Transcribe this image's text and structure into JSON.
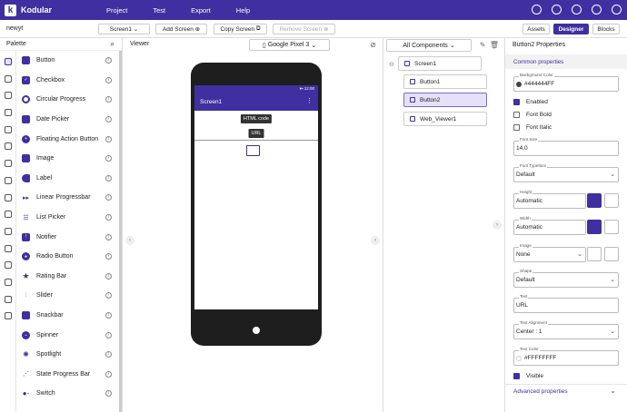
{
  "app": {
    "name": "Kodular",
    "logo_letter": "k"
  },
  "menu": [
    "Project",
    "Test",
    "Export",
    "Help"
  ],
  "toolbar": {
    "project_name": "newyt",
    "screen_select": "Screen1",
    "add_screen": "Add Screen",
    "copy_screen": "Copy Screen",
    "remove_screen": "Remove Screen",
    "assets": "Assets",
    "designer": "Designer",
    "blocks": "Blocks"
  },
  "palette": {
    "title": "Palette",
    "items": [
      "Button",
      "Checkbox",
      "Circular Progress",
      "Date Picker",
      "Floating Action Button",
      "Image",
      "Label",
      "Linear Progressbar",
      "List Picker",
      "Notifier",
      "Radio Button",
      "Rating Bar",
      "Slider",
      "Snackbar",
      "Spinner",
      "Spotlight",
      "State Progress Bar",
      "Switch"
    ]
  },
  "viewer": {
    "title": "Viewer",
    "device": "Google Pixel 3",
    "status_time": "12:00",
    "screen_title": "Screen1",
    "button1_text": "HTML code",
    "button2_text": "URL"
  },
  "components": {
    "filter": "All Components",
    "tree": [
      "Screen1",
      "Button1",
      "Button2",
      "Web_Viewer1"
    ]
  },
  "properties": {
    "title": "Button2 Properties",
    "section": "Common properties",
    "background_color_label": "Background Color",
    "background_color": "#444444FF",
    "enabled": "Enabled",
    "font_bold": "Font Bold",
    "font_italic": "Font Italic",
    "font_size_label": "Font Size",
    "font_size": "14.0",
    "font_typeface_label": "Font Typeface",
    "font_typeface": "Default",
    "height_label": "Height",
    "height": "Automatic",
    "width_label": "Width",
    "width": "Automatic",
    "image_label": "Image",
    "image": "None",
    "shape_label": "Shape",
    "shape": "Default",
    "text_label": "Text",
    "text": "URL",
    "text_alignment_label": "Text Alignment",
    "text_alignment": "Center : 1",
    "text_color_label": "Text Color",
    "text_color": "#FFFFFFFF",
    "visible": "Visible",
    "advanced": "Advanced properties"
  },
  "colors": {
    "accent": "#3f2fa0",
    "selected_bg": "#e7e0fb"
  }
}
